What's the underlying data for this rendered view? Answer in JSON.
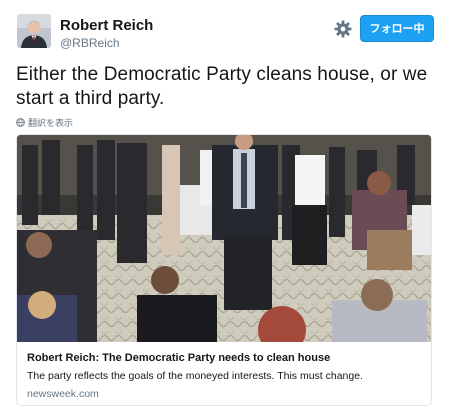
{
  "author": {
    "name": "Robert Reich",
    "handle": "@RBReich"
  },
  "actions": {
    "follow_label": "フォロー中",
    "settings_icon": "gear-icon"
  },
  "tweet": {
    "text": "Either the Democratic Party cleans house, or we start a third party.",
    "translate_label": "翻訳を表示",
    "translate_icon": "globe-icon"
  },
  "card": {
    "title": "Robert Reich: The Democratic Party needs to clean house",
    "description": "The party reflects the goals of the moneyed interests. This must change.",
    "domain": "newsweek.com"
  },
  "colors": {
    "accent": "#1da1f2",
    "text": "#14171a",
    "muted": "#657786",
    "border": "#e1e8ed"
  }
}
